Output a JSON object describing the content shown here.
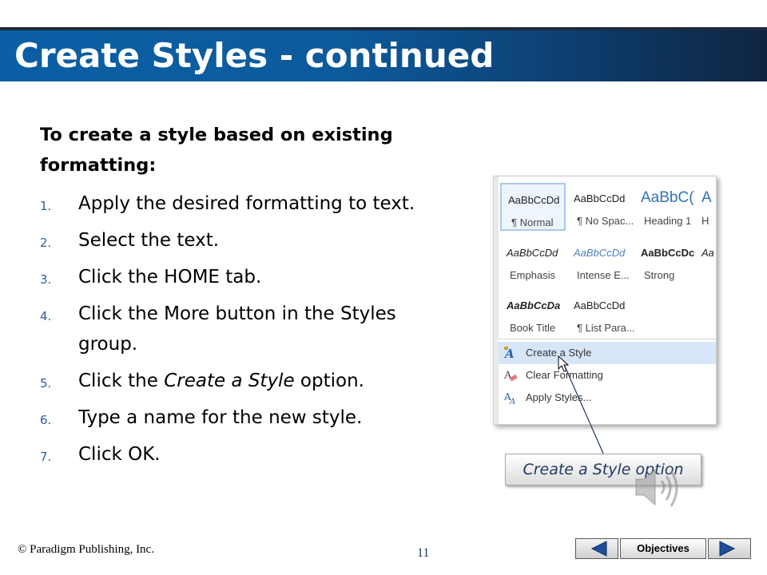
{
  "slide": {
    "title": "Create Styles - continued",
    "intro": "To create a style based on existing formatting:",
    "steps": [
      {
        "num": "1.",
        "lines": [
          "Apply the desired formatting to text."
        ]
      },
      {
        "num": "2.",
        "lines": [
          "Select the text."
        ]
      },
      {
        "num": "3.",
        "lines": [
          "Click the HOME tab."
        ]
      },
      {
        "num": "4.",
        "lines": [
          "Click the More button in the Styles",
          "group."
        ]
      },
      {
        "num": "5.",
        "pre": "Click the ",
        "em": "Create a Style",
        "post": " option."
      },
      {
        "num": "6.",
        "lines": [
          "Type a name for the new style."
        ]
      },
      {
        "num": "7.",
        "lines": [
          "Click OK."
        ]
      }
    ]
  },
  "styles_gallery": {
    "tiles": [
      {
        "sample": "AaBbCcDd",
        "name": "¶ Normal",
        "selected": true
      },
      {
        "sample": "AaBbCcDd",
        "name": "¶ No Spac..."
      },
      {
        "sample": "AaBbC(",
        "name": "Heading 1"
      },
      {
        "sample": "A",
        "name": "H"
      },
      {
        "sample": "AaBbCcDd",
        "name": "Emphasis"
      },
      {
        "sample": "AaBbCcDd",
        "name": "Intense E..."
      },
      {
        "sample": "AaBbCcDc",
        "name": "Strong"
      },
      {
        "sample": "Aa",
        "name": ""
      },
      {
        "sample": "AaBbCcDa",
        "name": "Book Title"
      },
      {
        "sample": "AaBbCcDd",
        "name": "¶ List Para..."
      }
    ],
    "menu": [
      {
        "label": "Create a Style",
        "icon": "create-style-icon",
        "hover": true
      },
      {
        "label": "Clear Formatting",
        "icon": "clear-formatting-icon"
      },
      {
        "label": "Apply Styles...",
        "icon": "apply-styles-icon"
      }
    ]
  },
  "callout": {
    "label": "Create a Style option"
  },
  "footer": {
    "copyright": "© Paradigm Publishing, Inc.",
    "page_number": "11",
    "nav": {
      "label": "Objectives",
      "prev_icon": "triangle-left-icon",
      "next_icon": "triangle-right-icon"
    }
  },
  "colors": {
    "title_bar": "#0b5fa5",
    "step_number": "#2b5fa8",
    "heading1": "#2e74b5",
    "intense": "#4f81bd",
    "menu_hover": "#d7e6f7"
  },
  "audio_icon": "speaker-icon"
}
